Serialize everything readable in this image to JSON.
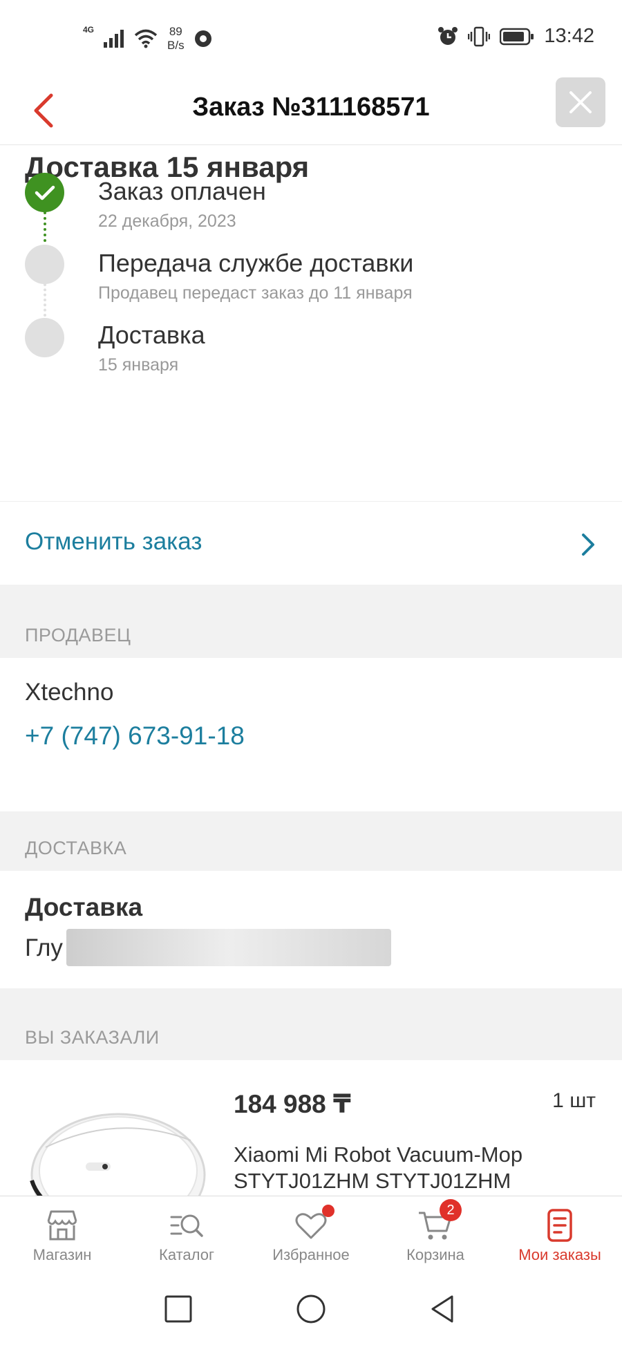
{
  "status_bar": {
    "network": "4G",
    "speed_value": "89",
    "speed_unit": "B/s",
    "time": "13:42"
  },
  "header": {
    "title": "Заказ №311168571"
  },
  "delivery": {
    "title": "Доставка 15 января",
    "steps": [
      {
        "title": "Заказ оплачен",
        "subtitle": "22 декабря, 2023",
        "done": true
      },
      {
        "title": "Передача службе доставки",
        "subtitle": "Продавец передаст заказ до 11 января",
        "done": false
      },
      {
        "title": "Доставка",
        "subtitle": "15 января",
        "done": false
      }
    ]
  },
  "cancel": {
    "label": "Отменить заказ"
  },
  "seller_section": {
    "heading": "ПРОДАВЕЦ",
    "name": "Xtechno",
    "phone": "+7 (747) 673-91-18"
  },
  "shipping_section": {
    "heading": "ДОСТАВКА",
    "title": "Доставка",
    "address_visible": "Глу"
  },
  "ordered_section": {
    "heading": "ВЫ ЗАКАЗАЛИ",
    "product": {
      "price": "184 988 ₸",
      "quantity": "1 шт",
      "name": "Xiaomi Mi Robot Vacuum-Mop STYTJ01ZHM STYTJ01ZHM"
    }
  },
  "bottom_nav": {
    "items": [
      {
        "label": "Магазин",
        "icon": "store-icon"
      },
      {
        "label": "Каталог",
        "icon": "catalog-search-icon"
      },
      {
        "label": "Избранное",
        "icon": "heart-icon"
      },
      {
        "label": "Корзина",
        "icon": "cart-icon",
        "badge": "2"
      },
      {
        "label": "Мои заказы",
        "icon": "orders-icon",
        "active": true
      }
    ]
  },
  "colors": {
    "accent_red": "#d93a2d",
    "link_blue": "#1c7e9e",
    "success_green": "#3f9221",
    "section_gray": "#f2f2f2"
  }
}
